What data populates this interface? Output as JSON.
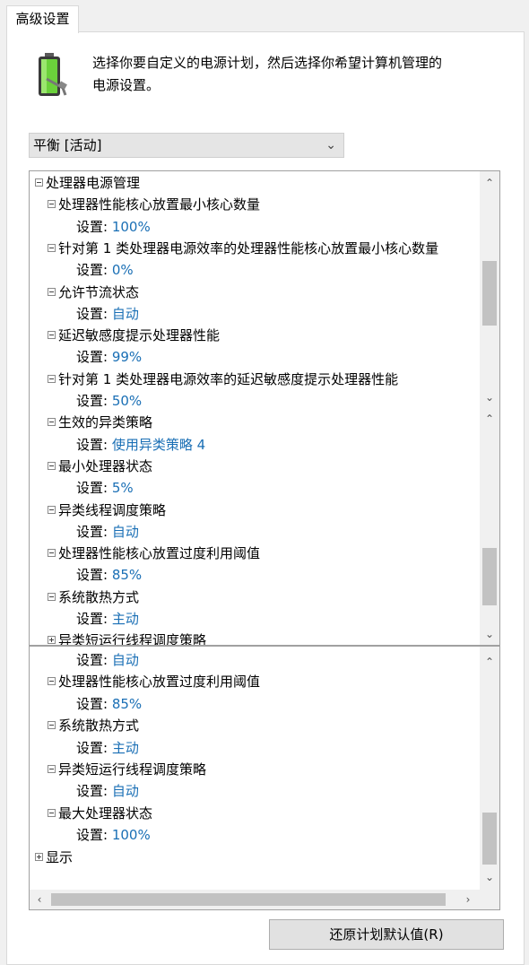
{
  "tab": {
    "label": "高级设置"
  },
  "description": {
    "line1": "选择你要自定义的电源计划，然后选择你希望计算机管理的",
    "line2": "电源设置。"
  },
  "plan_select": {
    "value": "平衡 [活动]"
  },
  "tree1": [
    {
      "kind": "group",
      "label": "处理器电源管理",
      "expander": "minus"
    },
    {
      "kind": "item",
      "label": "处理器性能核心放置最小核心数量",
      "expander": "minus"
    },
    {
      "kind": "setting",
      "label": "设置:",
      "value": "100%"
    },
    {
      "kind": "item",
      "label": "针对第 1 类处理器电源效率的处理器性能核心放置最小核心数量",
      "expander": "minus"
    },
    {
      "kind": "setting",
      "label": "设置:",
      "value": "0%"
    },
    {
      "kind": "item",
      "label": "允许节流状态",
      "expander": "minus"
    },
    {
      "kind": "setting",
      "label": "设置:",
      "value": "自动"
    },
    {
      "kind": "item",
      "label": "延迟敏感度提示处理器性能",
      "expander": "minus"
    },
    {
      "kind": "setting",
      "label": "设置:",
      "value": "99%"
    },
    {
      "kind": "item",
      "label": "针对第 1 类处理器电源效率的延迟敏感度提示处理器性能",
      "expander": "minus"
    },
    {
      "kind": "setting",
      "label": "设置:",
      "value": "50%"
    },
    {
      "kind": "item",
      "label": "生效的异类策略",
      "expander": "minus"
    },
    {
      "kind": "setting",
      "label": "设置:",
      "value": "使用异类策略 4"
    },
    {
      "kind": "item",
      "label": "最小处理器状态",
      "expander": "minus"
    },
    {
      "kind": "setting",
      "label": "设置:",
      "value": "5%"
    },
    {
      "kind": "item",
      "label": "异类线程调度策略",
      "expander": "minus"
    },
    {
      "kind": "setting",
      "label": "设置:",
      "value": "自动"
    },
    {
      "kind": "item",
      "label": "处理器性能核心放置过度利用阈值",
      "expander": "minus"
    },
    {
      "kind": "setting",
      "label": "设置:",
      "value": "85%"
    },
    {
      "kind": "item",
      "label": "系统散热方式",
      "expander": "minus"
    },
    {
      "kind": "setting",
      "label": "设置:",
      "value": "主动"
    },
    {
      "kind": "item",
      "label": "异类短运行线程调度策略",
      "expander": "plus"
    }
  ],
  "tree2": [
    {
      "kind": "setting",
      "label": "设置:",
      "value": "自动"
    },
    {
      "kind": "item",
      "label": "处理器性能核心放置过度利用阈值",
      "expander": "minus"
    },
    {
      "kind": "setting",
      "label": "设置:",
      "value": "85%"
    },
    {
      "kind": "item",
      "label": "系统散热方式",
      "expander": "minus"
    },
    {
      "kind": "setting",
      "label": "设置:",
      "value": "主动"
    },
    {
      "kind": "item",
      "label": "异类短运行线程调度策略",
      "expander": "minus"
    },
    {
      "kind": "setting",
      "label": "设置:",
      "value": "自动"
    },
    {
      "kind": "item",
      "label": "最大处理器状态",
      "expander": "minus"
    },
    {
      "kind": "setting",
      "label": "设置:",
      "value": "100%"
    },
    {
      "kind": "group",
      "label": "显示",
      "expander": "plus"
    }
  ],
  "restore_button": {
    "label": "还原计划默认值(R)"
  },
  "colors": {
    "value_blue": "#1a6fb5",
    "scroll_thumb": "#c2c2c2"
  },
  "icons": {
    "battery": "battery-plug-icon",
    "dropdown": "chevron-down-icon"
  }
}
